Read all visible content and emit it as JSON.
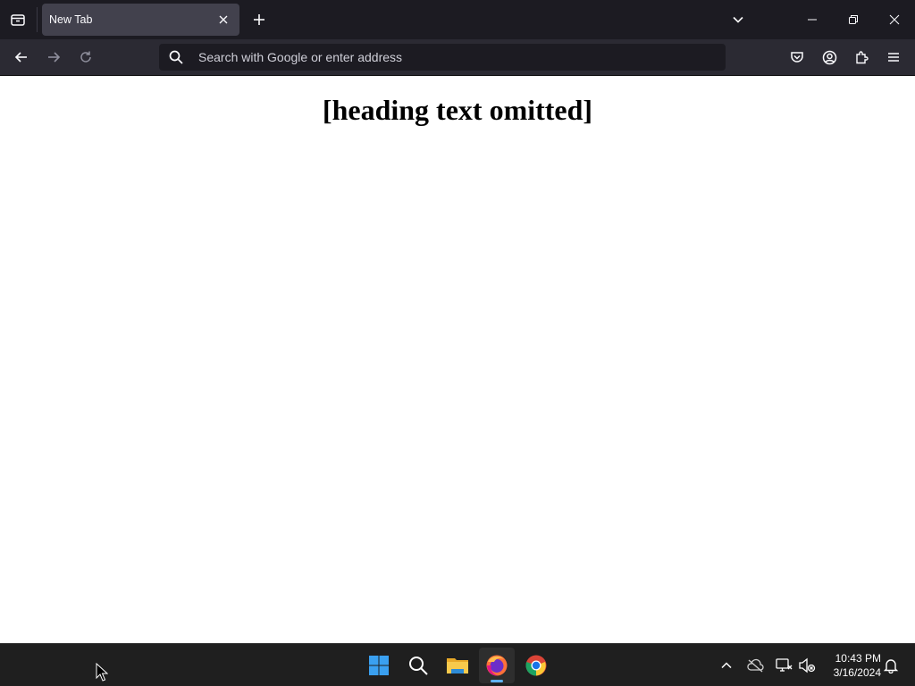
{
  "browser": {
    "tab": {
      "title": "New Tab"
    },
    "urlbar": {
      "placeholder": "Search with Google or enter address"
    },
    "icons": {
      "tab_list": "tab-list-icon",
      "tab_close": "close-icon",
      "new_tab": "plus-icon",
      "all_tabs": "chevron-down-icon",
      "minimize": "minimize-icon",
      "restore": "restore-icon",
      "close_window": "close-icon",
      "back": "arrow-left-icon",
      "forward": "arrow-right-icon",
      "reload": "reload-icon",
      "search": "search-icon",
      "pocket": "pocket-icon",
      "account": "account-icon",
      "extensions": "puzzle-icon",
      "menu": "hamburger-menu-icon"
    }
  },
  "content": {
    "heading": "[heading text omitted]"
  },
  "taskbar": {
    "apps": [
      "start",
      "search",
      "file-explorer",
      "firefox",
      "chrome"
    ],
    "active_app": "firefox",
    "clock": {
      "time": "10:43 PM",
      "date": "3/16/2024"
    }
  },
  "colors": {
    "tabstrip_bg": "#1c1b22",
    "toolbar_bg": "#2b2a33",
    "tab_bg": "#42414d",
    "urlbar_bg": "#1c1b22",
    "taskbar_bg": "#1f1f1f",
    "text_light": "#fbfbfe"
  }
}
